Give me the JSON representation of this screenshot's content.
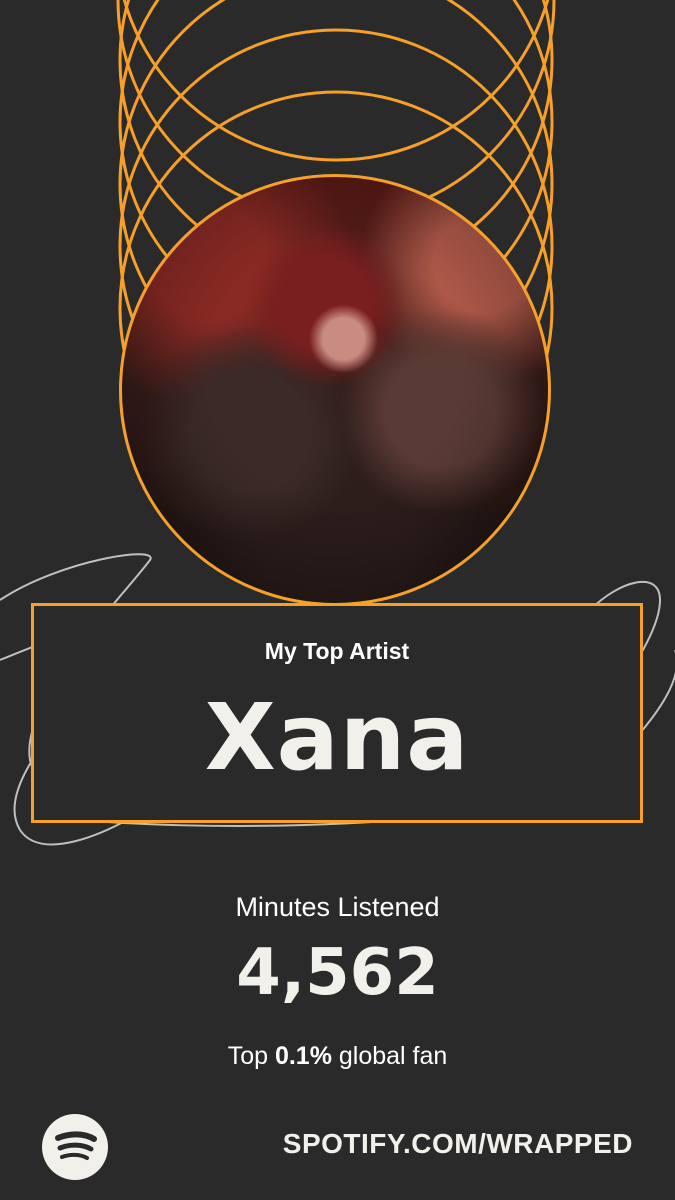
{
  "card": {
    "subtitle": "My Top Artist",
    "artist_name": "Xana",
    "stat_label": "Minutes Listened",
    "stat_value": "4,562",
    "fan_prefix": "Top ",
    "fan_percent": "0.1%",
    "fan_suffix": " global fan"
  },
  "footer": {
    "logo_icon": "spotify-logo-icon",
    "url": "SPOTIFY.COM/WRAPPED"
  },
  "colors": {
    "background": "#2a2a2a",
    "accent": "#f6a02a",
    "text": "#f2f0ea"
  }
}
